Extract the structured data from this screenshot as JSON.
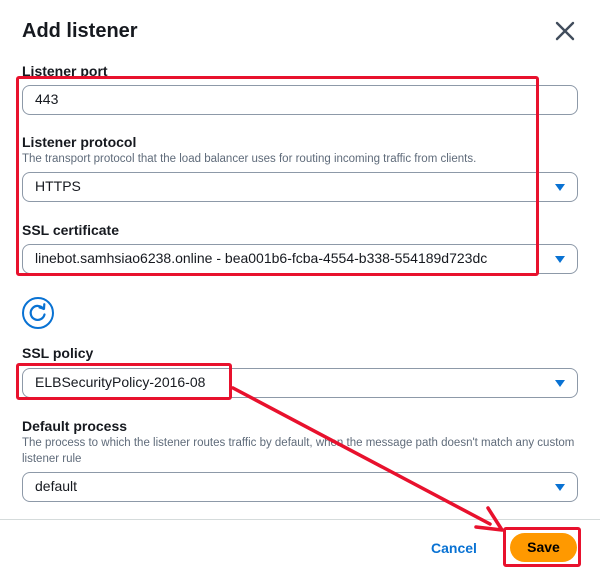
{
  "dialog": {
    "title": "Add listener"
  },
  "listener_port": {
    "label": "Listener port",
    "value": "443"
  },
  "listener_protocol": {
    "label": "Listener protocol",
    "description": "The transport protocol that the load balancer uses for routing incoming traffic from clients.",
    "value": "HTTPS"
  },
  "ssl_certificate": {
    "label": "SSL certificate",
    "value": "linebot.samhsiao6238.online - bea001b6-fcba-4554-b338-554189d723dc"
  },
  "ssl_policy": {
    "label": "SSL policy",
    "value": "ELBSecurityPolicy-2016-08"
  },
  "default_process": {
    "label": "Default process",
    "description": "The process to which the listener routes traffic by default, when the message path doesn't match any custom listener rule",
    "value": "default"
  },
  "footer": {
    "cancel_label": "Cancel",
    "save_label": "Save"
  },
  "colors": {
    "accent": "#0972d3",
    "primary_button": "#ff9900",
    "annotation": "#e8112d"
  }
}
